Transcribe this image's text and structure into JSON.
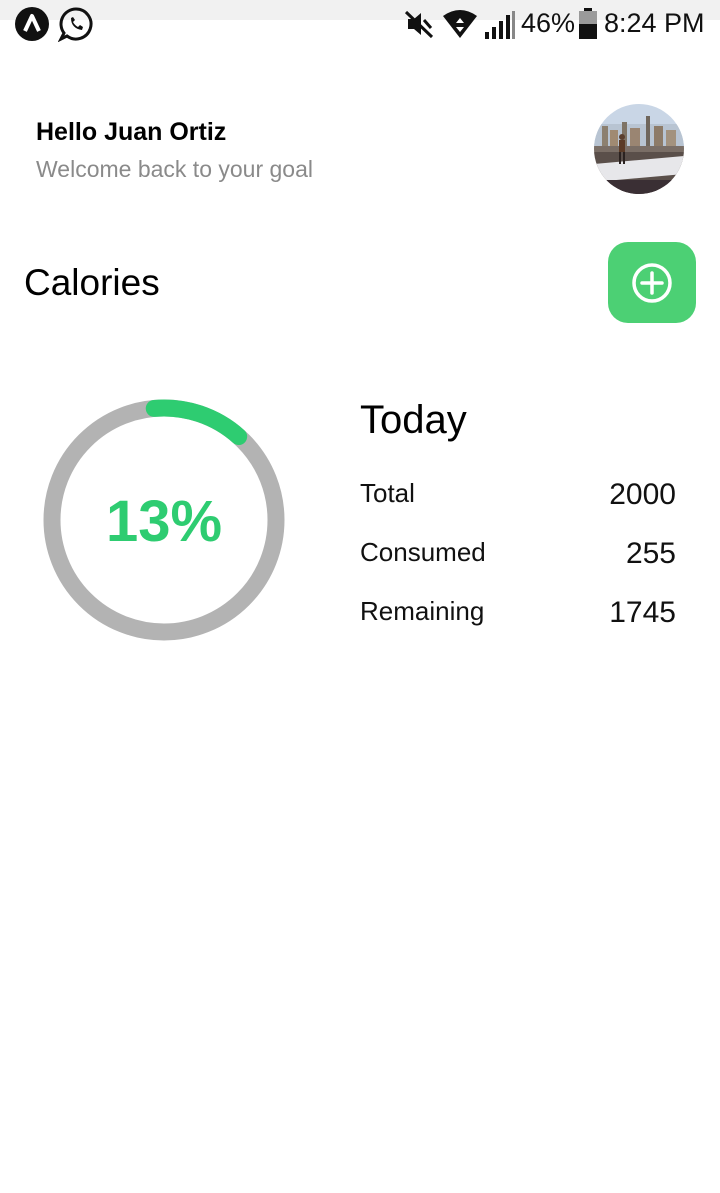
{
  "status_bar": {
    "battery_percent": "46%",
    "time": "8:24 PM",
    "icons": [
      "app-logo-icon",
      "whatsapp-icon",
      "mute-icon",
      "wifi-icon",
      "signal-icon",
      "battery-icon"
    ]
  },
  "header": {
    "greeting": "Hello Juan Ortiz",
    "subtitle": "Welcome back to your goal"
  },
  "calories": {
    "title": "Calories",
    "add_icon": "plus-circle-icon",
    "progress": 0.13,
    "progress_label": "13%",
    "today_title": "Today",
    "stats": [
      {
        "label": "Total",
        "value": "2000"
      },
      {
        "label": "Consumed",
        "value": "255"
      },
      {
        "label": "Remaining",
        "value": "1745"
      }
    ]
  },
  "colors": {
    "accent": "#2ecc71",
    "button": "#4cd074",
    "ring_track": "#b3b3b3",
    "subtitle": "#8a8a8a"
  }
}
